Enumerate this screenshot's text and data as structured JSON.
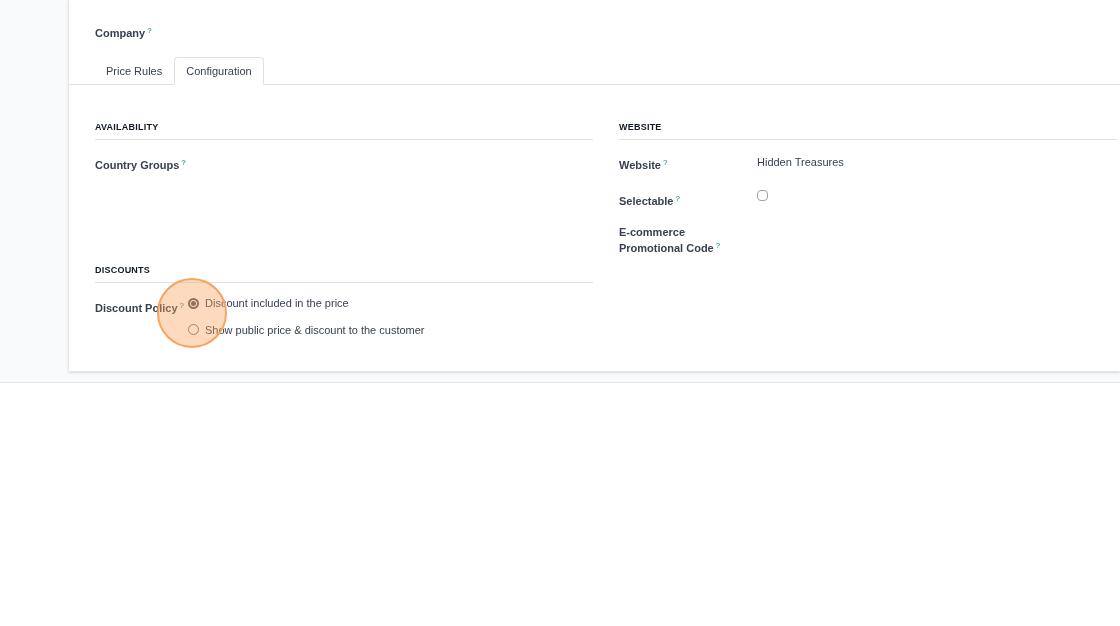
{
  "company_label": "Company",
  "help_mark": "?",
  "tabs": [
    {
      "label": "Price Rules",
      "selected": false
    },
    {
      "label": "Configuration",
      "selected": true
    }
  ],
  "availability": {
    "heading": "AVAILABILITY",
    "fields": [
      {
        "label": "Country Groups"
      }
    ]
  },
  "website": {
    "heading": "WEBSITE",
    "fields": [
      {
        "label": "Website",
        "kind": "text",
        "value": "Hidden Treasures"
      },
      {
        "label": "Selectable",
        "kind": "checkbox",
        "checked": false
      },
      {
        "label": "E-commerce Promotional Code",
        "kind": "text"
      }
    ]
  },
  "discounts": {
    "heading": "DISCOUNTS",
    "label": "Discount Policy",
    "options": [
      {
        "label": "Discount included in the price",
        "selected": true
      },
      {
        "label": "Show public price & discount to the customer",
        "selected": false
      }
    ]
  },
  "click_marker": {
    "shown": true
  }
}
